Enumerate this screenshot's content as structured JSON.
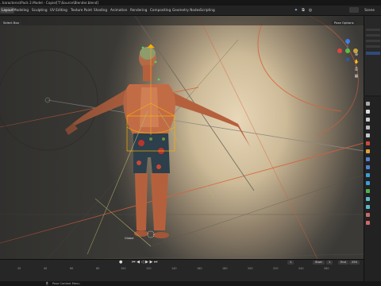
{
  "window": {
    "title": "..haracterss\\Pack 2.Model - Copie/[T:\\Source\\Blender.blend]"
  },
  "topbar": {
    "workspaces": [
      "Layout",
      "Modeling",
      "Sculpting",
      "UV Editing",
      "Texture Paint",
      "Shading",
      "Animation",
      "Rendering",
      "Compositing",
      "Geometry Nodes",
      "Scripting"
    ],
    "active_workspace": "Layout",
    "scene_label": "Scene"
  },
  "viewport": {
    "select_mode": "Select Box",
    "pose_options": "Pose Options",
    "bone_label": "Global"
  },
  "timeline": {
    "current_frame": "1",
    "start_label": "Start",
    "start_value": "1",
    "end_label": "End",
    "end_value": "250",
    "ruler_ticks": [
      "20",
      "40",
      "60",
      "80",
      "100",
      "120",
      "140",
      "160",
      "180",
      "200",
      "220",
      "240",
      "260"
    ]
  },
  "statusbar": {
    "text": "Pose Context Menu"
  },
  "colors": {
    "accent": "#e8a33b",
    "bone_orange": "#ffb000",
    "guide_red": "#d9603a"
  }
}
